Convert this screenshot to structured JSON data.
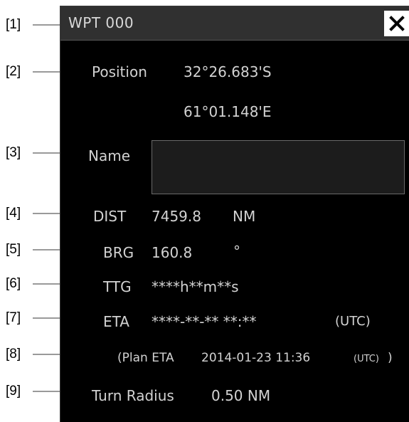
{
  "callouts": [
    "[1]",
    "[2]",
    "[3]",
    "[4]",
    "[5]",
    "[6]",
    "[7]",
    "[8]",
    "[9]"
  ],
  "panel": {
    "title": "WPT 000",
    "close_icon": "close-x-icon",
    "position_label": "Position",
    "lat": "32°26.683'S",
    "lon": "61°01.148'E",
    "name_label": "Name",
    "name_value": "",
    "dist_label": "DIST",
    "dist_value": "7459.8",
    "dist_unit": "NM",
    "brg_label": "BRG",
    "brg_value": "160.8",
    "brg_unit": "°",
    "ttg_label": "TTG",
    "ttg_value": "****h**m**s",
    "eta_label": "ETA",
    "eta_value": "****-**-** **:**",
    "eta_tz": "(UTC)",
    "plan_eta_prefix": "(Plan ETA",
    "plan_eta_value": "2014-01-23 11:36",
    "plan_eta_tz": "(UTC)",
    "plan_eta_suffix": ")",
    "turn_radius_label": "Turn Radius",
    "turn_radius_value": "0.50 NM"
  },
  "colors": {
    "panel_bg": "#000000",
    "titlebar_bg": "#303030",
    "text": "#d2d2d2",
    "leader_line": "#9a9a9a"
  }
}
